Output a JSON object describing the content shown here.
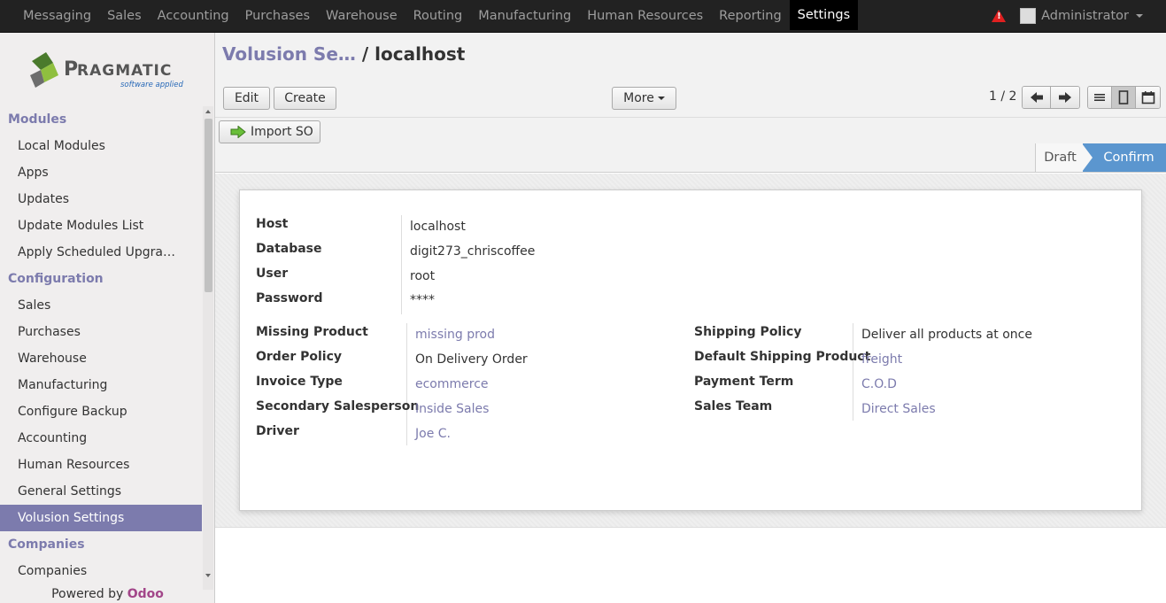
{
  "topmenu": [
    "Messaging",
    "Sales",
    "Accounting",
    "Purchases",
    "Warehouse",
    "Routing",
    "Manufacturing",
    "Human Resources",
    "Reporting",
    "Settings"
  ],
  "active_menu": "Settings",
  "user": {
    "name": "Administrator"
  },
  "logo": {
    "brand": "PRAGMATIC",
    "tagline": "software applied"
  },
  "sidebar": {
    "sections": [
      {
        "title": "Modules",
        "items": [
          "Local Modules",
          "Apps",
          "Updates",
          "Update Modules List",
          "Apply Scheduled Upgra…"
        ]
      },
      {
        "title": "Configuration",
        "items": [
          "Sales",
          "Purchases",
          "Warehouse",
          "Manufacturing",
          "Configure Backup",
          "Accounting",
          "Human Resources",
          "General Settings",
          "Volusion Settings"
        ]
      },
      {
        "title": "Companies",
        "items": [
          "Companies"
        ]
      }
    ],
    "active_item": "Volusion Settings",
    "powered_prefix": "Powered by ",
    "powered_brand": "Odoo"
  },
  "breadcrumb": {
    "parent": "Volusion Se…",
    "sep": " / ",
    "current": "localhost"
  },
  "toolbar": {
    "edit": "Edit",
    "create": "Create",
    "more": "More",
    "pager": "1 / 2"
  },
  "actions": {
    "import": "Import SO"
  },
  "stages": {
    "draft": "Draft",
    "confirm": "Confirm",
    "active": "Confirm"
  },
  "form": {
    "host_label": "Host",
    "host": "localhost",
    "database_label": "Database",
    "database": "digit273_chriscoffee",
    "user_label": "User",
    "user": "root",
    "password_label": "Password",
    "password": "****",
    "missing_product_label": "Missing Product",
    "missing_product": "missing prod",
    "order_policy_label": "Order Policy",
    "order_policy": "On Delivery Order",
    "invoice_type_label": "Invoice Type",
    "invoice_type": "ecommerce",
    "secondary_salesperson_label": "Secondary Salesperson",
    "secondary_salesperson": "Inside Sales",
    "driver_label": "Driver",
    "driver": "Joe C.",
    "shipping_policy_label": "Shipping Policy",
    "shipping_policy": "Deliver all products at once",
    "default_shipping_product_label": "Default Shipping Product",
    "default_shipping_product": "freight",
    "payment_term_label": "Payment Term",
    "payment_term": "C.O.D",
    "sales_team_label": "Sales Team",
    "sales_team": "Direct Sales"
  },
  "colors": {
    "accent": "#7c7bad",
    "topbar": "#222222",
    "stage_active": "#5b96cf",
    "warning": "#e02020"
  }
}
